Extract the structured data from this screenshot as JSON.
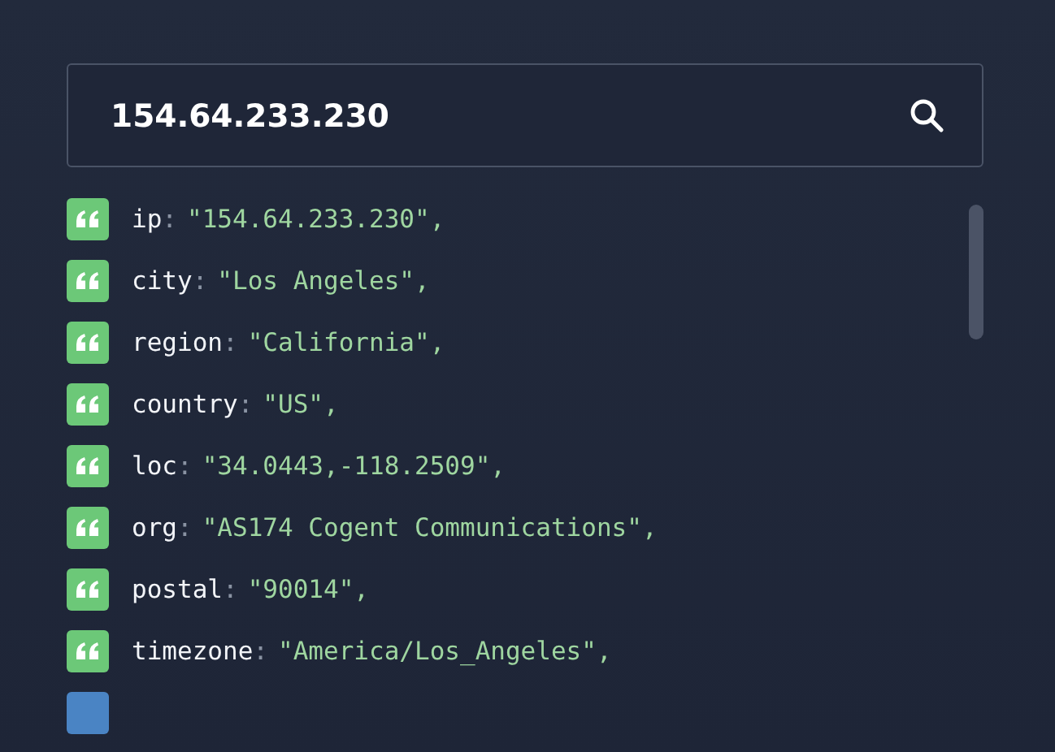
{
  "search": {
    "value": "154.64.233.230"
  },
  "fields": [
    {
      "kind": "string",
      "key": "ip",
      "separator": ":",
      "value": "\"154.64.233.230\","
    },
    {
      "kind": "string",
      "key": "city",
      "separator": ":",
      "value": "\"Los Angeles\","
    },
    {
      "kind": "string",
      "key": "region",
      "separator": ":",
      "value": "\"California\","
    },
    {
      "kind": "string",
      "key": "country",
      "separator": ":",
      "value": "\"US\","
    },
    {
      "kind": "string",
      "key": "loc",
      "separator": ":",
      "value": "\"34.0443,-118.2509\","
    },
    {
      "kind": "string",
      "key": "org",
      "separator": ":",
      "value": "\"AS174 Cogent Communications\","
    },
    {
      "kind": "string",
      "key": "postal",
      "separator": ":",
      "value": "\"90014\","
    },
    {
      "kind": "string",
      "key": "timezone",
      "separator": ":",
      "value": "\"America/Los_Angeles\","
    },
    {
      "kind": "object"
    }
  ]
}
